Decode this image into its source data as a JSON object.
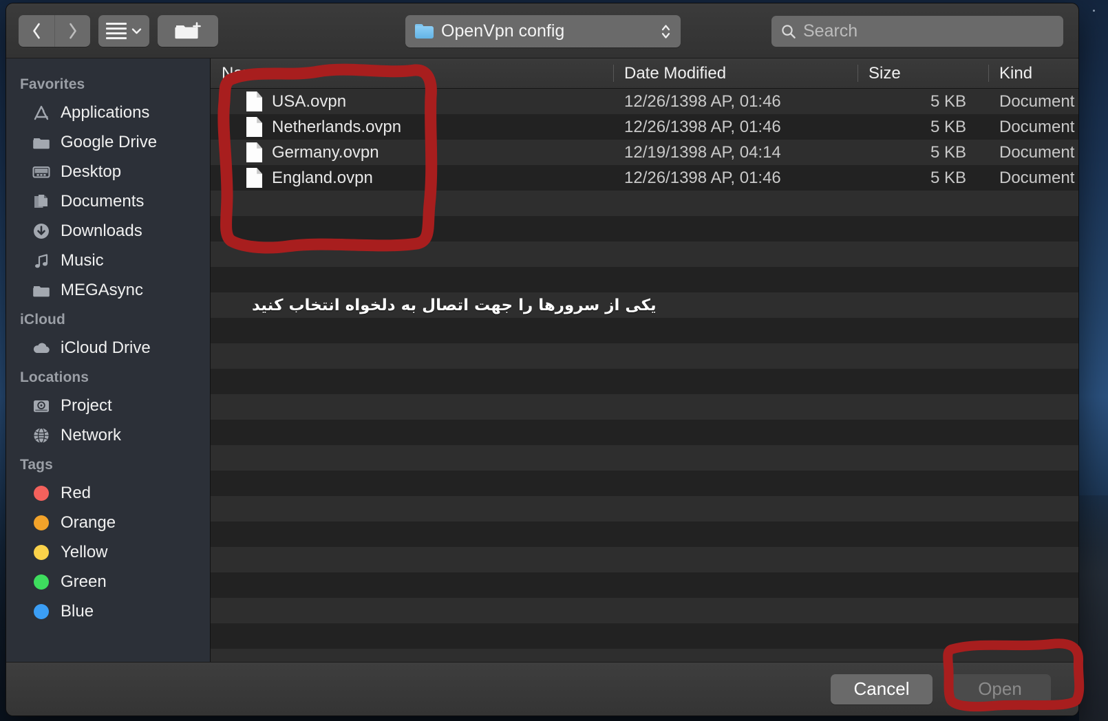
{
  "window": {
    "title": "Open file dialog"
  },
  "toolbar": {
    "back_icon": "chevron-left-icon",
    "forward_icon": "chevron-right-icon",
    "view_mode_icon": "list-view-icon",
    "view_mode_caret_icon": "chevron-down-icon",
    "new_folder_icon": "new-folder-icon",
    "path_popup": {
      "icon": "folder-icon",
      "label": "OpenVpn config",
      "stepper_icon": "up-down-chevron-icon"
    },
    "search": {
      "icon": "search-icon",
      "placeholder": "Search",
      "value": ""
    }
  },
  "sidebar": {
    "sections": [
      {
        "heading": "Favorites",
        "items": [
          {
            "label": "Applications",
            "icon": "applications-icon"
          },
          {
            "label": "Google Drive",
            "icon": "folder-icon"
          },
          {
            "label": "Desktop",
            "icon": "desktop-icon"
          },
          {
            "label": "Documents",
            "icon": "documents-icon"
          },
          {
            "label": "Downloads",
            "icon": "downloads-icon"
          },
          {
            "label": "Music",
            "icon": "music-note-icon"
          },
          {
            "label": "MEGAsync",
            "icon": "folder-icon"
          }
        ]
      },
      {
        "heading": "iCloud",
        "items": [
          {
            "label": "iCloud Drive",
            "icon": "cloud-icon"
          }
        ]
      },
      {
        "heading": "Locations",
        "items": [
          {
            "label": "Project",
            "icon": "hard-drive-icon"
          },
          {
            "label": "Network",
            "icon": "globe-icon"
          }
        ]
      },
      {
        "heading": "Tags",
        "items": [
          {
            "label": "Red",
            "icon": "tag-dot-icon",
            "color": "#f4615c"
          },
          {
            "label": "Orange",
            "icon": "tag-dot-icon",
            "color": "#f3a32a"
          },
          {
            "label": "Yellow",
            "icon": "tag-dot-icon",
            "color": "#fbd24a"
          },
          {
            "label": "Green",
            "icon": "tag-dot-icon",
            "color": "#3edd5e"
          },
          {
            "label": "Blue",
            "icon": "tag-dot-icon",
            "color": "#3b9ef5"
          }
        ]
      }
    ]
  },
  "file_list": {
    "columns": [
      "Name",
      "Date Modified",
      "Size",
      "Kind"
    ],
    "rows": [
      {
        "name": "USA.ovpn",
        "date": "12/26/1398 AP, 01:46",
        "size": "5 KB",
        "kind": "Document",
        "icon": "document-icon"
      },
      {
        "name": "Netherlands.ovpn",
        "date": "12/26/1398 AP, 01:46",
        "size": "5 KB",
        "kind": "Document",
        "icon": "document-icon"
      },
      {
        "name": "Germany.ovpn",
        "date": "12/19/1398 AP, 04:14",
        "size": "5 KB",
        "kind": "Document",
        "icon": "document-icon"
      },
      {
        "name": "England.ovpn",
        "date": "12/26/1398 AP, 01:46",
        "size": "5 KB",
        "kind": "Document",
        "icon": "document-icon"
      }
    ]
  },
  "annotations": {
    "color": "#a81e1e",
    "file_list_highlight": "hand-drawn rectangle around the four .ovpn files",
    "open_button_highlight": "hand-drawn rectangle around the Open button",
    "note_fa": "یکی از سرورها را جهت اتصال به دلخواه انتخاب کنید"
  },
  "footer": {
    "cancel_label": "Cancel",
    "open_label": "Open",
    "open_disabled": true
  }
}
